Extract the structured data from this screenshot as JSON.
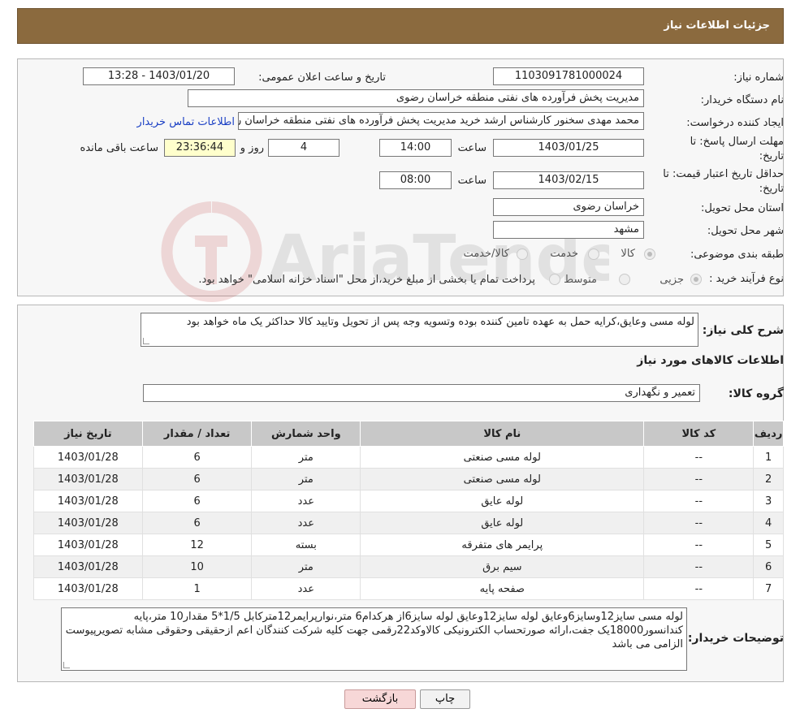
{
  "header": {
    "title": "جزئیات اطلاعات نیاز"
  },
  "form": {
    "need_number_label": "شماره نیاز:",
    "need_number": "1103091781000024",
    "announce_label": "تاریخ و ساعت اعلان عمومی:",
    "announce_value": "1403/01/20 - 13:28",
    "buyer_org_label": "نام دستگاه خریدار:",
    "buyer_org": "مدیریت پخش فرآورده های نفتی منطقه خراسان رضوی",
    "creator_label": "ایجاد کننده درخواست:",
    "creator": "محمد مهدی سخنور کارشناس ارشد خرید مدیریت پخش فرآورده های نفتی منطقه خراسان رضوی",
    "contact_link": "اطلاعات تماس خریدار",
    "deadline_label_1": "مهلت ارسال پاسخ: تا",
    "deadline_label_2": "تاریخ:",
    "deadline_date": "1403/01/25",
    "time_label": "ساعت",
    "deadline_time": "14:00",
    "days_value": "4",
    "days_label": "روز و",
    "remaining_time": "23:36:44",
    "remaining_label": "ساعت باقی مانده",
    "validity_label_1": "حداقل تاریخ اعتبار قیمت: تا",
    "validity_label_2": "تاریخ:",
    "validity_date": "1403/02/15",
    "validity_time": "08:00",
    "province_label": "استان محل تحویل:",
    "province": "خراسان رضوی",
    "city_label": "شهر محل تحویل:",
    "city": "مشهد",
    "category_label": "طبقه بندی موضوعی:",
    "category_options": [
      "کالا",
      "خدمت",
      "کالا/خدمت"
    ],
    "process_label": "نوع فرآیند خرید :",
    "process_options": [
      "جزیی",
      "متوسط"
    ],
    "process_note": "پرداخت تمام یا بخشی از مبلغ خرید،از محل \"اسناد خزانه اسلامی\" خواهد بود."
  },
  "summary": {
    "label": "شرح کلی نیاز:",
    "text": "لوله مسی وعایق،کرایه حمل به عهده تامین کننده بوده وتسویه وجه پس از تحویل وتایید کالا حداکثر یک ماه خواهد بود"
  },
  "goods": {
    "section_title": "اطلاعات کالاهای مورد نیاز",
    "group_label": "گروه کالا:",
    "group_value": "تعمیر و نگهداری"
  },
  "table": {
    "headers": [
      "ردیف",
      "کد کالا",
      "نام کالا",
      "واحد شمارش",
      "تعداد / مقدار",
      "تاریخ نیاز"
    ],
    "rows": [
      [
        "1",
        "--",
        "لوله مسی صنعتی",
        "متر",
        "6",
        "1403/01/28"
      ],
      [
        "2",
        "--",
        "لوله مسی صنعتی",
        "متر",
        "6",
        "1403/01/28"
      ],
      [
        "3",
        "--",
        "لوله عایق",
        "عدد",
        "6",
        "1403/01/28"
      ],
      [
        "4",
        "--",
        "لوله عایق",
        "عدد",
        "6",
        "1403/01/28"
      ],
      [
        "5",
        "--",
        "پرایمر های متفرقه",
        "بسته",
        "12",
        "1403/01/28"
      ],
      [
        "6",
        "--",
        "سیم برق",
        "متر",
        "10",
        "1403/01/28"
      ],
      [
        "7",
        "--",
        "صفحه پایه",
        "عدد",
        "1",
        "1403/01/28"
      ]
    ]
  },
  "buyer_notes": {
    "label": "توضیحات خریدار:",
    "text": "لوله مسی سایز12وسایز6وعایق لوله سایز12وعایق لوله سایز6از هرکدام6 متر،نوارپرایمر12مترکابل 1/5*5 مقدار10 متر،پایه کندانسور18000یک جفت،ارائه صورتحساب الکترونیکی کالاوکد22رقمی جهت کلیه شرکت کنندگان اعم ازحقیقی وحقوقی مشابه تصویرپیوست الزامی می باشد"
  },
  "buttons": {
    "print": "چاپ",
    "back": "بازگشت"
  },
  "watermark": {
    "text": "AriaTender.neT"
  }
}
